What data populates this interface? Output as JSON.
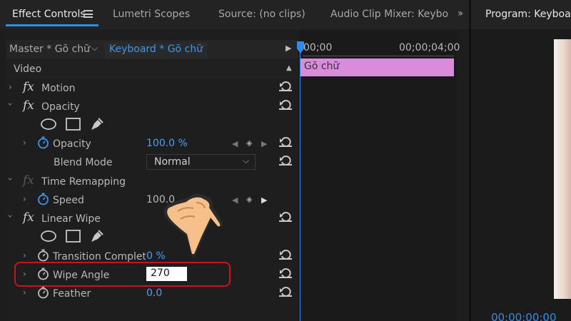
{
  "tabs": [
    {
      "label": "Effect Controls",
      "active": true
    },
    {
      "label": "Lumetri Scopes",
      "active": false
    },
    {
      "label": "Source: (no clips)",
      "active": false
    },
    {
      "label": "Audio Clip Mixer: Keybo",
      "active": false
    }
  ],
  "program_tab": {
    "label": "Program: Keyboard"
  },
  "source_bar": {
    "master": "Master * Gõ chữ",
    "sequence_clip": "Keyboard * Gõ chữ"
  },
  "timeline": {
    "start_time": "00;00",
    "end_time": "00;00;04;00",
    "clip_label": "Gõ chữ",
    "clip_color": "#d98cd9"
  },
  "section": {
    "label": "Video"
  },
  "effects": {
    "motion": {
      "label": "Motion"
    },
    "opacity": {
      "label": "Opacity",
      "opacity_param": {
        "label": "Opacity",
        "value": "100.0 %"
      },
      "blend_mode": {
        "label": "Blend Mode",
        "value": "Normal"
      }
    },
    "time_remapping": {
      "label": "Time Remapping",
      "speed": {
        "label": "Speed",
        "value": "100.0"
      }
    },
    "linear_wipe": {
      "label": "Linear Wipe",
      "transition_completion": {
        "label": "Transition Complet...",
        "value": "0 %"
      },
      "wipe_angle": {
        "label": "Wipe Angle",
        "value": "270"
      },
      "feather": {
        "label": "Feather",
        "value": "0.0"
      }
    }
  },
  "program_monitor": {
    "timecode": "00;00;00;00"
  },
  "colors": {
    "accent": "#2d8ceb",
    "highlight_border": "#c8151d",
    "value_blue": "#4a9ff0"
  }
}
